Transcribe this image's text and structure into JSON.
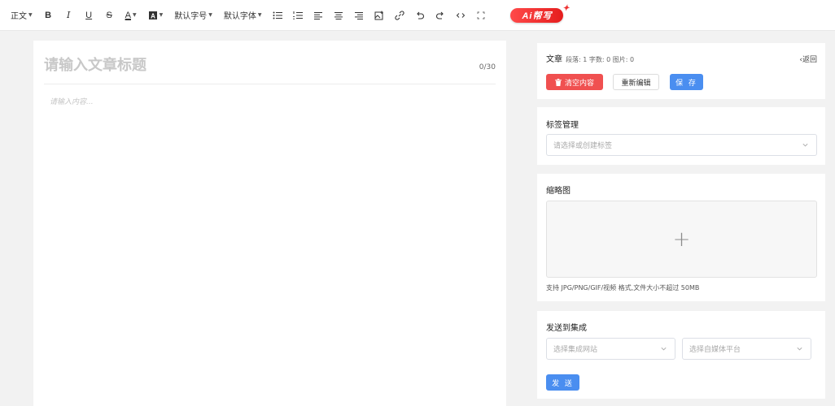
{
  "toolbar": {
    "paragraph_label": "正文",
    "bold_label": "B",
    "italic_label": "I",
    "underline_label": "U",
    "strike_label": "S",
    "font_color_label": "A",
    "font_size_label": "默认字号",
    "font_family_label": "默认字体",
    "ai_label": "Ai帮写"
  },
  "editor": {
    "title_placeholder": "请输入文章标题",
    "title_count": "0/30",
    "content_placeholder": "请输入内容..."
  },
  "article": {
    "title": "文章",
    "stats": "段落: 1 字数: 0 图片: 0",
    "back_label": "返回",
    "clear_label": "清空内容",
    "reedit_label": "重新编辑",
    "save_label": "保 存"
  },
  "tags": {
    "title": "标签管理",
    "placeholder": "请选择或创建标签"
  },
  "thumbnail": {
    "title": "缩略图",
    "hint": "支持 JPG/PNG/GIF/视频 格式,文件大小不超过 50MB"
  },
  "send": {
    "title": "发送到集成",
    "site_placeholder": "选择集成网站",
    "platform_placeholder": "选择自媒体平台",
    "send_label": "发 送"
  },
  "colors": {
    "danger": "#f05050",
    "primary": "#4a8ef0",
    "ai_red": "#e51d1d"
  }
}
